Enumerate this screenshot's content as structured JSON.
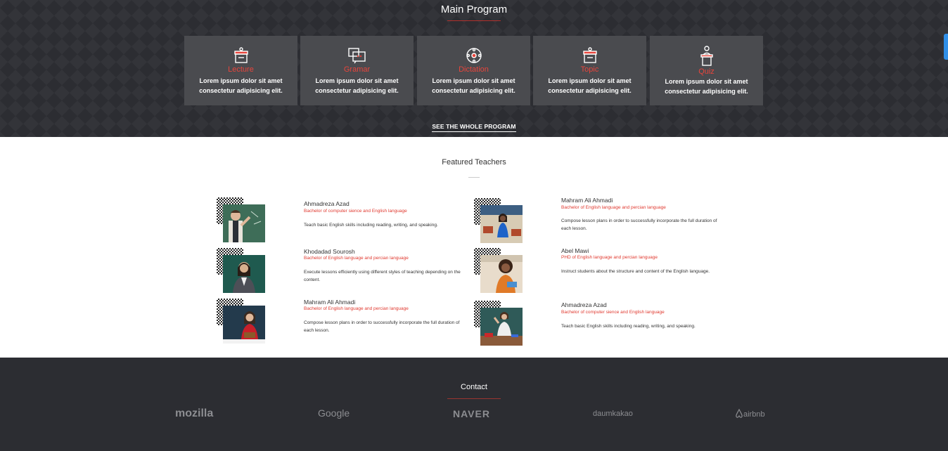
{
  "program": {
    "title": "Main Program",
    "cards": [
      {
        "label": "Lecture",
        "icon": "presentation-board-icon",
        "line1": "Lorem ipsum dolor sit amet",
        "line2": "consectetur adipisicing elit."
      },
      {
        "label": "Gramar",
        "icon": "chat-screen-icon",
        "line1": "Lorem ipsum dolor sit amet",
        "line2": "consectetur adipisicing elit."
      },
      {
        "label": "Dictation",
        "icon": "gear-network-icon",
        "line1": "Lorem ipsum dolor sit amet",
        "line2": "consectetur adipisicing elit."
      },
      {
        "label": "Topic",
        "icon": "presentation-board-icon",
        "line1": "Lorem ipsum dolor sit amet",
        "line2": "consectetur adipisicing elit."
      },
      {
        "label": "Quiz",
        "icon": "speaker-podium-icon",
        "line1": "Lorem ipsum dolor sit amet",
        "line2": "consectetur adipisicing elit."
      }
    ],
    "see_all": "SEE THE WHOLE PROGRAM"
  },
  "teachers": {
    "title": "Featured Teachers",
    "list": [
      {
        "name": "Ahmadreza Azad",
        "degree": "Bachelor of computer sience and English language",
        "text": "Teach basic English skills including reading, writing, and speaking."
      },
      {
        "name": "Mahram Ali Ahmadi",
        "degree": "Bachelor of English language and percian language",
        "text": "Compose lesson plans in order to successfully incorporate the full duration of each lesson."
      },
      {
        "name": "Khodadad Sourosh",
        "degree": "Bachelor of English language and percian language",
        "text": "Execute lessons efficiently using different styles of teaching depending on the content."
      },
      {
        "name": "Abel Mawi",
        "degree": "PHD of English language and percian language",
        "text": "Instruct students about the structure and content of the English language."
      },
      {
        "name": "Mahram Ali Ahmadi",
        "degree": "Bachelor of English language and percian language",
        "text": "Compose lesson plans in order to successfully incorporate the full duration of each lesson."
      },
      {
        "name": "Ahmadreza Azad",
        "degree": "Bachelor of computer sience and English language",
        "text": "Teach basic English skills including reading, writing, and speaking."
      }
    ]
  },
  "contact": {
    "title": "Contact",
    "partners": [
      "mozilla",
      "Google",
      "NAVER",
      "daumkakao",
      "airbnb"
    ]
  },
  "colors": {
    "dark_bg": "#2c2d32",
    "card_bg": "#4a4b4f",
    "accent_red": "#e8453c",
    "scroll_blue": "#2f8fe8"
  }
}
